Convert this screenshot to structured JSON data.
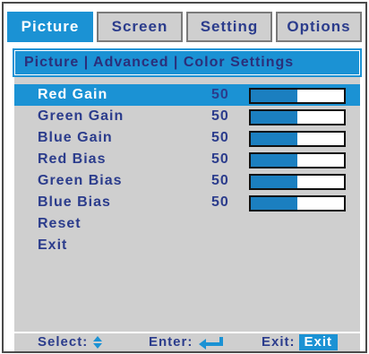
{
  "tabs": [
    {
      "label": "Picture",
      "active": true
    },
    {
      "label": "Screen",
      "active": false
    },
    {
      "label": "Setting",
      "active": false
    },
    {
      "label": "Options",
      "active": false
    }
  ],
  "breadcrumb": "Picture | Advanced | Color Settings",
  "settings": [
    {
      "label": "Red Gain",
      "value": "50",
      "level": 0.5,
      "selected": true
    },
    {
      "label": "Green Gain",
      "value": "50",
      "level": 0.5,
      "selected": false
    },
    {
      "label": "Blue Gain",
      "value": "50",
      "level": 0.5,
      "selected": false
    },
    {
      "label": "Red Bias",
      "value": "50",
      "level": 0.5,
      "selected": false
    },
    {
      "label": "Green Bias",
      "value": "50",
      "level": 0.5,
      "selected": false
    },
    {
      "label": "Blue Bias",
      "value": "50",
      "level": 0.5,
      "selected": false
    },
    {
      "label": "Reset",
      "selected": false
    },
    {
      "label": "Exit",
      "selected": false
    }
  ],
  "footer": {
    "select_label": "Select:",
    "select_icon": "up-down-arrow-icon",
    "enter_label": "Enter:",
    "enter_icon": "enter-return-icon",
    "exit_label": "Exit:",
    "exit_badge": "Exit"
  },
  "colors": {
    "accent": "#1b92d4",
    "panel": "#cfcfcf",
    "text": "#2b3c8c",
    "bar_fill": "#1b7fc0"
  }
}
